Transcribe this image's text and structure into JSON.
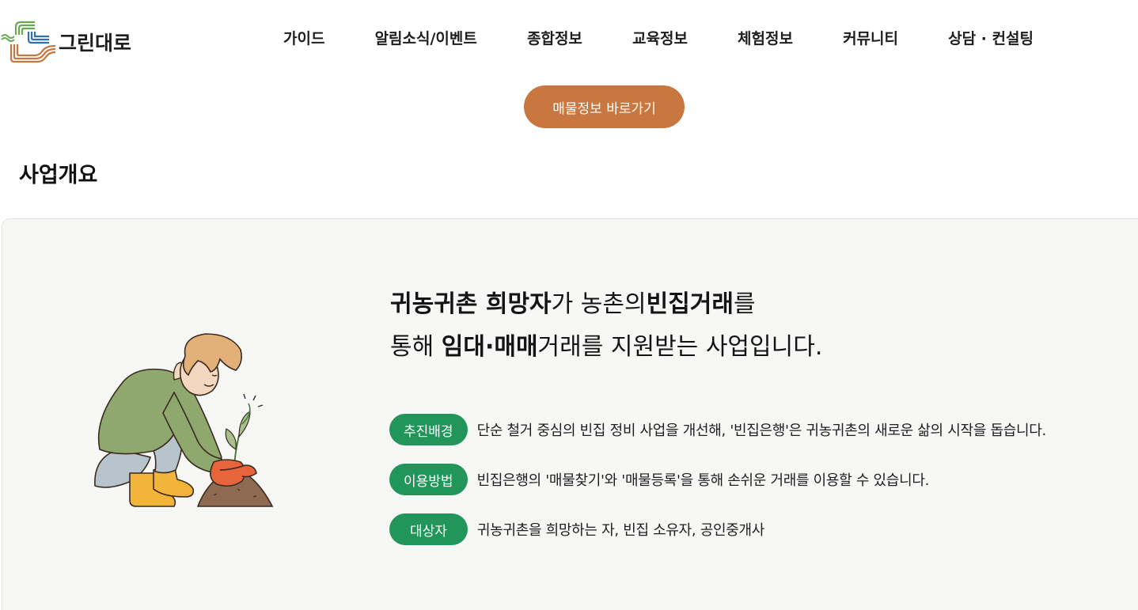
{
  "brand": {
    "name": "그린대로",
    "logo_icon": "green-road-lines-logo",
    "colors": {
      "green": "#6aa84f",
      "blue": "#2f6fb3",
      "brown": "#c7773f"
    }
  },
  "nav": {
    "items": [
      {
        "label": "가이드"
      },
      {
        "label": "알림소식/이벤트"
      },
      {
        "label": "종합정보"
      },
      {
        "label": "교육정보"
      },
      {
        "label": "체험정보"
      },
      {
        "label": "커뮤니티"
      },
      {
        "label": "상담 · 컨설팅"
      }
    ]
  },
  "cta": {
    "label": "매물정보 바로가기",
    "color": "#c7773f"
  },
  "section": {
    "title": "사업개요"
  },
  "headline": {
    "line1": [
      {
        "text": "귀농귀촌 희망자",
        "bold": true
      },
      {
        "text": "가 농촌의",
        "bold": false
      },
      {
        "text": "빈집거래",
        "bold": true
      },
      {
        "text": "를",
        "bold": false
      }
    ],
    "line2": [
      {
        "text": "통해 ",
        "bold": false
      },
      {
        "text": "임대·매매",
        "bold": true
      },
      {
        "text": "거래를 지원받는 사업입니다.",
        "bold": false
      }
    ]
  },
  "illustration": {
    "icon": "person-planting-seedling-illustration"
  },
  "info": {
    "badge_color": "#22965a",
    "rows": [
      {
        "badge": "추진배경",
        "text": "단순 철거 중심의 빈집 정비 사업을 개선해, '빈집은행'은 귀농귀촌의 새로운 삶의 시작을 돕습니다."
      },
      {
        "badge": "이용방법",
        "text": "빈집은행의 '매물찾기'와 '매물등록'을 통해 손쉬운 거래를 이용할 수 있습니다."
      },
      {
        "badge": "대상자",
        "text": "귀농귀촌을 희망하는 자, 빈집 소유자, 공인중개사"
      }
    ]
  }
}
